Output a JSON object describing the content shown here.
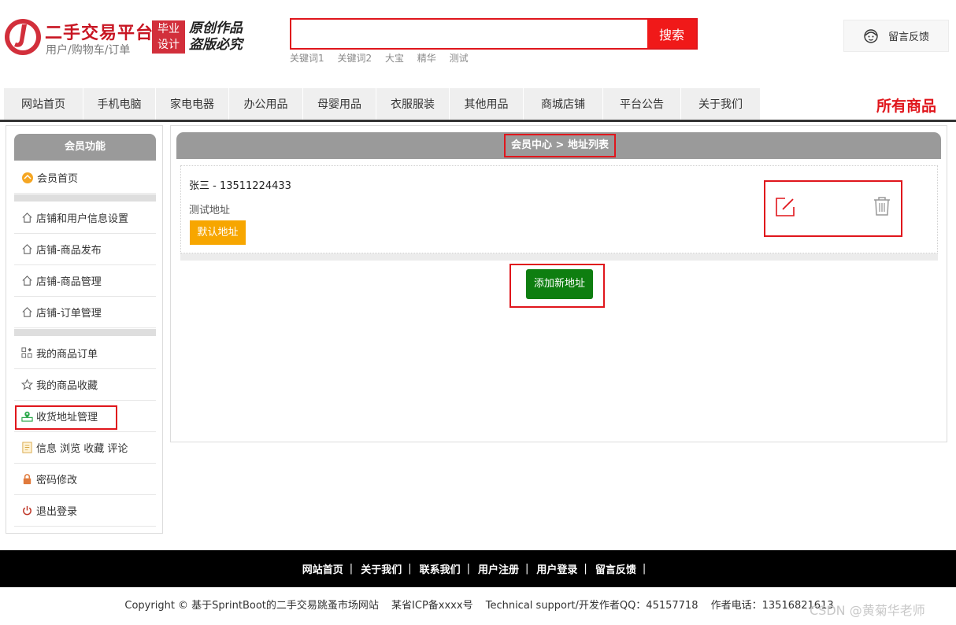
{
  "header": {
    "title": "二手交易平台",
    "subtitle": "用户/购物车/订单",
    "badge": [
      "毕业",
      "设计"
    ],
    "slogan": [
      "原创作品",
      "盗版必究"
    ],
    "search": {
      "placeholder": "",
      "button": "搜索"
    },
    "keywords": [
      "关键词1",
      "关键词2",
      "大宝",
      "精华",
      "测试"
    ],
    "feedback_label": "留言反馈"
  },
  "nav": {
    "items": [
      "网站首页",
      "手机电脑",
      "家电电器",
      "办公用品",
      "母婴用品",
      "衣服服装",
      "其他用品",
      "商城店铺",
      "平台公告",
      "关于我们"
    ],
    "all_goods": "所有商品"
  },
  "sidebar": {
    "header": "会员功能",
    "home": "会员首页",
    "shop_items": [
      "店铺和用户信息设置",
      "店铺-商品发布",
      "店铺-商品管理",
      "店铺-订单管理"
    ],
    "user_items": [
      "我的商品订单",
      "我的商品收藏",
      "收货地址管理",
      "信息 浏览 收藏 评论",
      "密码修改",
      "退出登录"
    ]
  },
  "main": {
    "breadcrumb": "会员中心 > 地址列表",
    "address": {
      "name_phone": "张三 - 13511224433",
      "detail": "测试地址",
      "default_label": "默认地址"
    },
    "add_button": "添加新地址"
  },
  "footer": {
    "links": [
      "网站首页",
      "关于我们",
      "联系我们",
      "用户注册",
      "用户登录",
      "留言反馈"
    ],
    "copyright": "Copyright © 基于SprintBoot的二手交易跳蚤市场网站",
    "icp": "某省ICP备xxxx号",
    "support": "Technical support/开发作者QQ：45157718",
    "phone": "作者电话：13516821613",
    "watermark": "CSDN @黄菊华老师"
  },
  "colors": {
    "brand_red": "#e0161c",
    "nav_bg": "#efefef",
    "default_orange": "#f7a600",
    "add_green": "#0e7e10",
    "side_header": "#9a9a9a"
  }
}
